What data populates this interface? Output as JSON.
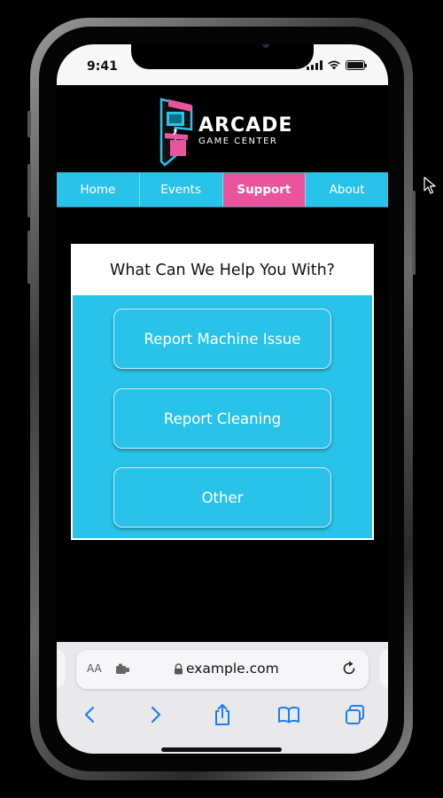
{
  "status_bar": {
    "time": "9:41"
  },
  "logo": {
    "title": "ARCADE",
    "subtitle": "GAME CENTER"
  },
  "nav": {
    "items": [
      {
        "label": "Home"
      },
      {
        "label": "Events"
      },
      {
        "label": "Support",
        "active": true
      },
      {
        "label": "About"
      }
    ]
  },
  "help": {
    "title": "What Can We Help You With?",
    "options": [
      {
        "label": "Report Machine Issue"
      },
      {
        "label": "Report Cleaning"
      },
      {
        "label": "Other"
      }
    ]
  },
  "browser": {
    "text_size_label": "AA",
    "url": "example.com",
    "icons": [
      "lock-icon",
      "reload-icon",
      "back-icon",
      "forward-icon",
      "share-icon",
      "bookmarks-icon",
      "tabs-icon",
      "extension-icon"
    ]
  },
  "colors": {
    "accent_cyan": "#29c3ea",
    "accent_pink": "#e9549c",
    "toolbar_blue": "#1a7df5"
  }
}
